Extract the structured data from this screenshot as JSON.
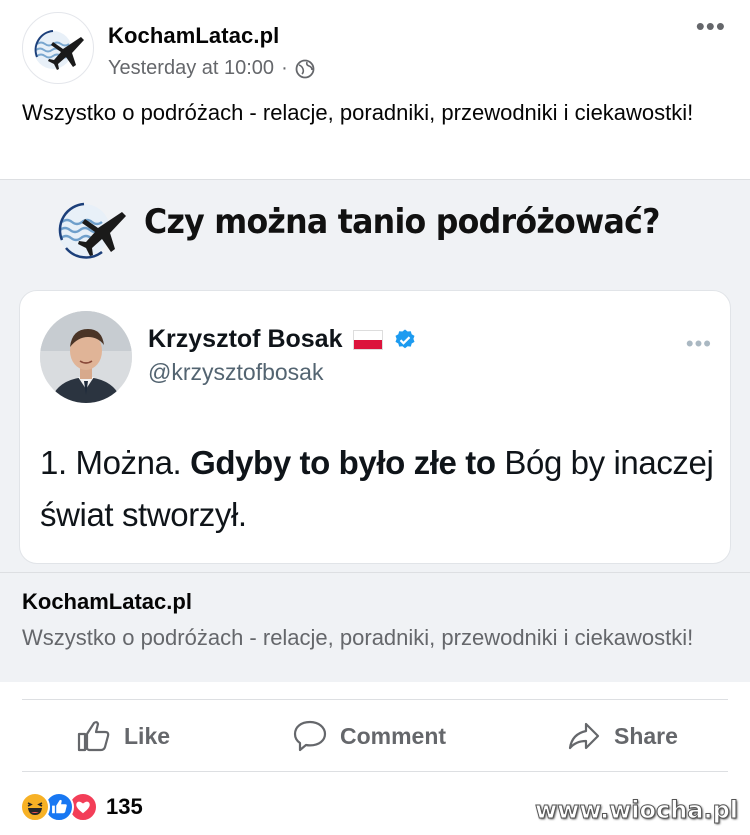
{
  "post": {
    "page_name": "KochamLatac.pl",
    "timestamp": "Yesterday at 10:00",
    "separator": "·",
    "more_icon": "more-horizontal-icon",
    "caption": "Wszystko o podróżach - relacje, poradniki, przewodniki i ciekawostki!"
  },
  "image": {
    "headline": "Czy można tanio podróżować?",
    "tweet": {
      "name": "Krzysztof Bosak",
      "handle": "@krzysztofbosak",
      "text_part1": "1. Można. ",
      "text_bold": "Gdyby to było złe to",
      "text_part2": " Bóg by inaczej świat stworzył."
    }
  },
  "link_preview": {
    "title": "KochamLatac.pl",
    "description": "Wszystko o podróżach - relacje, poradniki, przewodniki i ciekawostki!"
  },
  "actions": {
    "like": "Like",
    "comment": "Comment",
    "share": "Share"
  },
  "reactions": {
    "count": "135",
    "types": [
      "haha",
      "like",
      "love"
    ]
  },
  "watermark": "www.wiocha.pl",
  "colors": {
    "secondary_text": "#65676b",
    "like_blue": "#1877f2",
    "love_red": "#f33e58",
    "haha_yellow": "#f7b125",
    "verified_blue": "#1d9bf0"
  }
}
